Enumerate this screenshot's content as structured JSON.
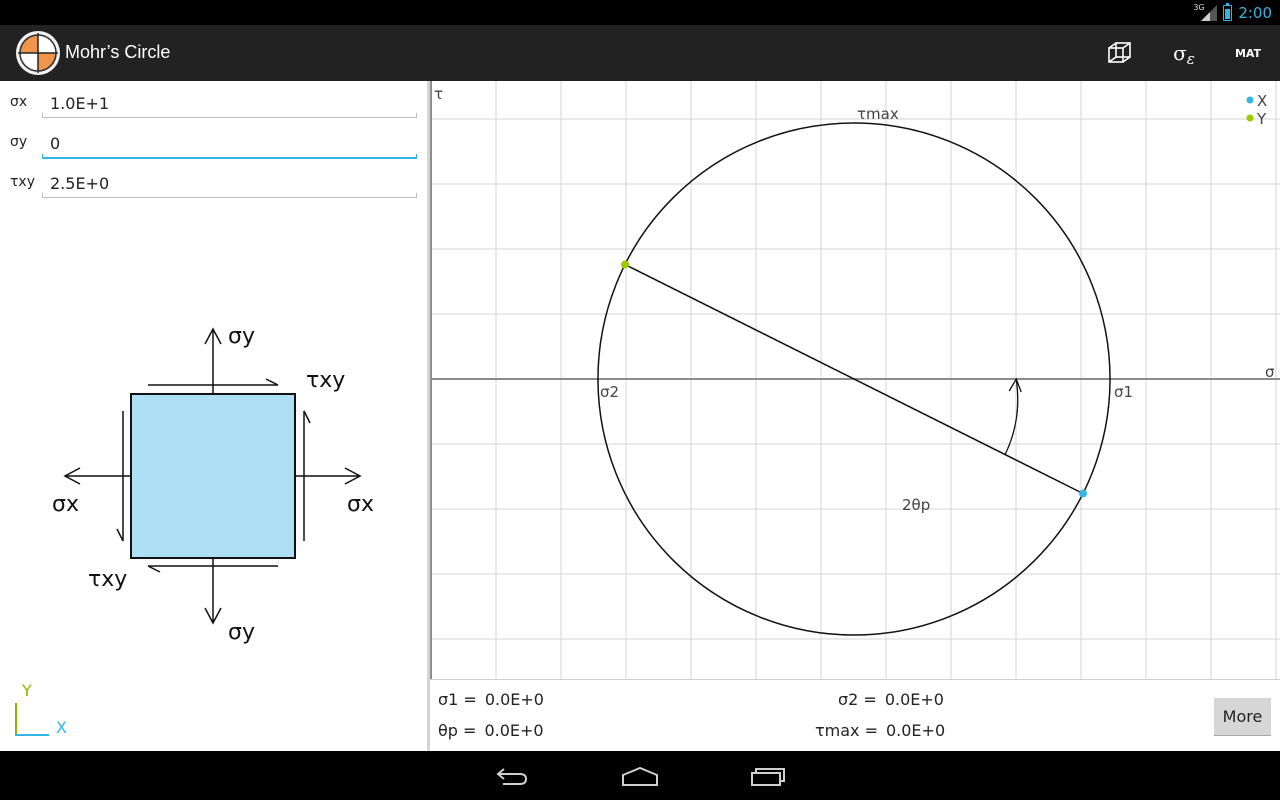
{
  "status_bar": {
    "network": "3G",
    "time": "2:00"
  },
  "app": {
    "title": "Mohr’s Circle"
  },
  "action_bar": {
    "cube_icon": "cube-icon",
    "sigma_label": "σ",
    "epsilon_label": "ε",
    "mat_label": "MAT"
  },
  "inputs": [
    {
      "label": "σx",
      "value": "1.0E+1"
    },
    {
      "label": "σy",
      "value": "0"
    },
    {
      "label": "τxy",
      "value": "2.5E+0"
    }
  ],
  "element_diagram": {
    "sigma_y_top": "σy",
    "sigma_y_bottom": "σy",
    "sigma_x_left": "σx",
    "sigma_x_right": "σx",
    "tau_xy_top": "τxy",
    "tau_xy_bottom": "τxy",
    "fill_color": "#aee0f5"
  },
  "axes_indicator": {
    "y": "Y",
    "x": "X",
    "y_color": "#8db600",
    "x_color": "#33b5e5"
  },
  "chart_data": {
    "type": "scatter",
    "x_axis_label": "σ",
    "y_axis_label": "τ",
    "legend": [
      {
        "name": "X",
        "color": "#33b5e5"
      },
      {
        "name": "Y",
        "color": "#99cc00"
      }
    ],
    "legend_placement": "top-right",
    "grid": true,
    "points": {
      "X": {
        "sigma": 10,
        "tau": -2.5,
        "color": "#33b5e5"
      },
      "Y": {
        "sigma": 0,
        "tau": 2.5,
        "color": "#99cc00"
      }
    },
    "labels": {
      "sigma1": "σ1",
      "sigma2": "σ2",
      "tau_max": "τmax",
      "angle": "2θp"
    }
  },
  "results": {
    "sigma1_label": "σ1 =",
    "sigma1": "0.0E+0",
    "sigma2_label": "σ2 =",
    "sigma2": "0.0E+0",
    "theta_p_label": "θp =",
    "theta_p": "0.0E+0",
    "tau_max_label": "τmax =",
    "tau_max": "0.0E+0",
    "more_label": "More"
  }
}
